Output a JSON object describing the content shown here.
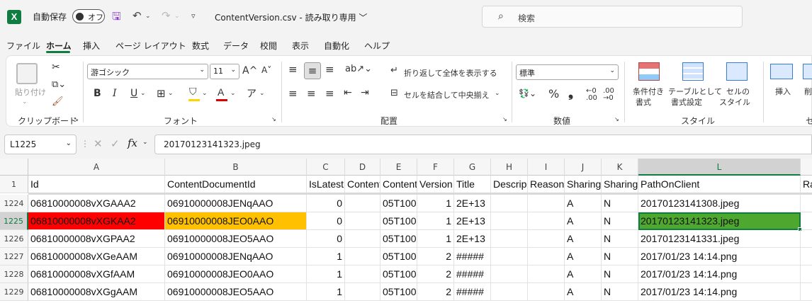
{
  "titlebar": {
    "logo": "X",
    "autosave_label": "自動保存",
    "autosave_toggle": "オフ",
    "doc_title": "ContentVersion.csv  -  読み取り専用 ﹀",
    "search_placeholder": "検索"
  },
  "menu": [
    "ファイル",
    "ホーム",
    "挿入",
    "ページ レイアウト",
    "数式",
    "データ",
    "校閲",
    "表示",
    "自動化",
    "ヘルプ"
  ],
  "ribbon": {
    "clipboard": {
      "label": "クリップボード",
      "paste": "貼り付け"
    },
    "font": {
      "label": "フォント",
      "name": "游ゴシック",
      "size": "11",
      "grow": "A^",
      "shrink": "A˅",
      "bold": "B",
      "italic": "I",
      "underline": "U"
    },
    "alignment": {
      "label": "配置",
      "wrap": "折り返して全体を表示する",
      "merge": "セルを結合して中央揃え"
    },
    "number": {
      "label": "数値",
      "format": "標準",
      "percent": "%",
      "comma": "❟"
    },
    "styles": {
      "label": "スタイル",
      "conditional_1": "条件付き",
      "conditional_2": "書式",
      "table_1": "テーブルとして",
      "table_2": "書式設定",
      "cell_1": "セルの",
      "cell_2": "スタイル"
    },
    "cells": {
      "insert": "挿入",
      "delete": "削",
      "label_partial": "セ"
    }
  },
  "formula_bar": {
    "name_box": "L1225",
    "fx": "fx",
    "formula": "20170123141323.jpeg"
  },
  "sheet": {
    "columns": [
      {
        "letter": "A",
        "header": "Id"
      },
      {
        "letter": "B",
        "header": "ContentDocumentId"
      },
      {
        "letter": "C",
        "header": "IsLatest"
      },
      {
        "letter": "D",
        "header": "Content"
      },
      {
        "letter": "E",
        "header": "Content"
      },
      {
        "letter": "F",
        "header": "Version"
      },
      {
        "letter": "G",
        "header": "Title"
      },
      {
        "letter": "H",
        "header": "Descrip"
      },
      {
        "letter": "I",
        "header": "Reason"
      },
      {
        "letter": "J",
        "header": "Sharing"
      },
      {
        "letter": "K",
        "header": "Sharing"
      },
      {
        "letter": "L",
        "header": "PathOnClient"
      },
      {
        "letter": "",
        "header": "Ra"
      }
    ],
    "header_row_number": "1",
    "rows": [
      {
        "num": "1224",
        "cells": [
          "06810000008vXGAAA2",
          "06910000008JENqAAO",
          "0",
          "",
          "05T100",
          "1",
          "2E+13",
          "",
          "",
          "A",
          "N",
          "20170123141308.jpeg",
          ""
        ]
      },
      {
        "num": "1225",
        "cells": [
          "06810000008vXGKAA2",
          "06910000008JEO0AAO",
          "0",
          "",
          "05T100",
          "1",
          "2E+13",
          "",
          "",
          "A",
          "N",
          "20170123141323.jpeg",
          ""
        ]
      },
      {
        "num": "1226",
        "cells": [
          "06810000008vXGPAA2",
          "06910000008JEO5AAO",
          "0",
          "",
          "05T100",
          "1",
          "2E+13",
          "",
          "",
          "A",
          "N",
          "20170123141331.jpeg",
          ""
        ]
      },
      {
        "num": "1227",
        "cells": [
          "06810000008vXGeAAM",
          "06910000008JENqAAO",
          "1",
          "",
          "05T100",
          "2",
          "#####",
          "",
          "",
          "A",
          "N",
          "2017/01/23 14:14.png",
          ""
        ]
      },
      {
        "num": "1228",
        "cells": [
          "06810000008vXGfAAM",
          "06910000008JEO0AAO",
          "1",
          "",
          "05T100",
          "2",
          "#####",
          "",
          "",
          "A",
          "N",
          "2017/01/23 14:14.png",
          ""
        ]
      },
      {
        "num": "1229",
        "cells": [
          "06810000008vXGgAAM",
          "06910000008JEO5AAO",
          "1",
          "",
          "05T100",
          "2",
          "#####",
          "",
          "",
          "A",
          "N",
          "2017/01/23 14:14.png",
          ""
        ]
      }
    ],
    "highlight_colors": {
      "red": "#ff0000",
      "orange": "#ffc000",
      "green": "#4ea72e"
    },
    "selected_cell": "L1225"
  }
}
